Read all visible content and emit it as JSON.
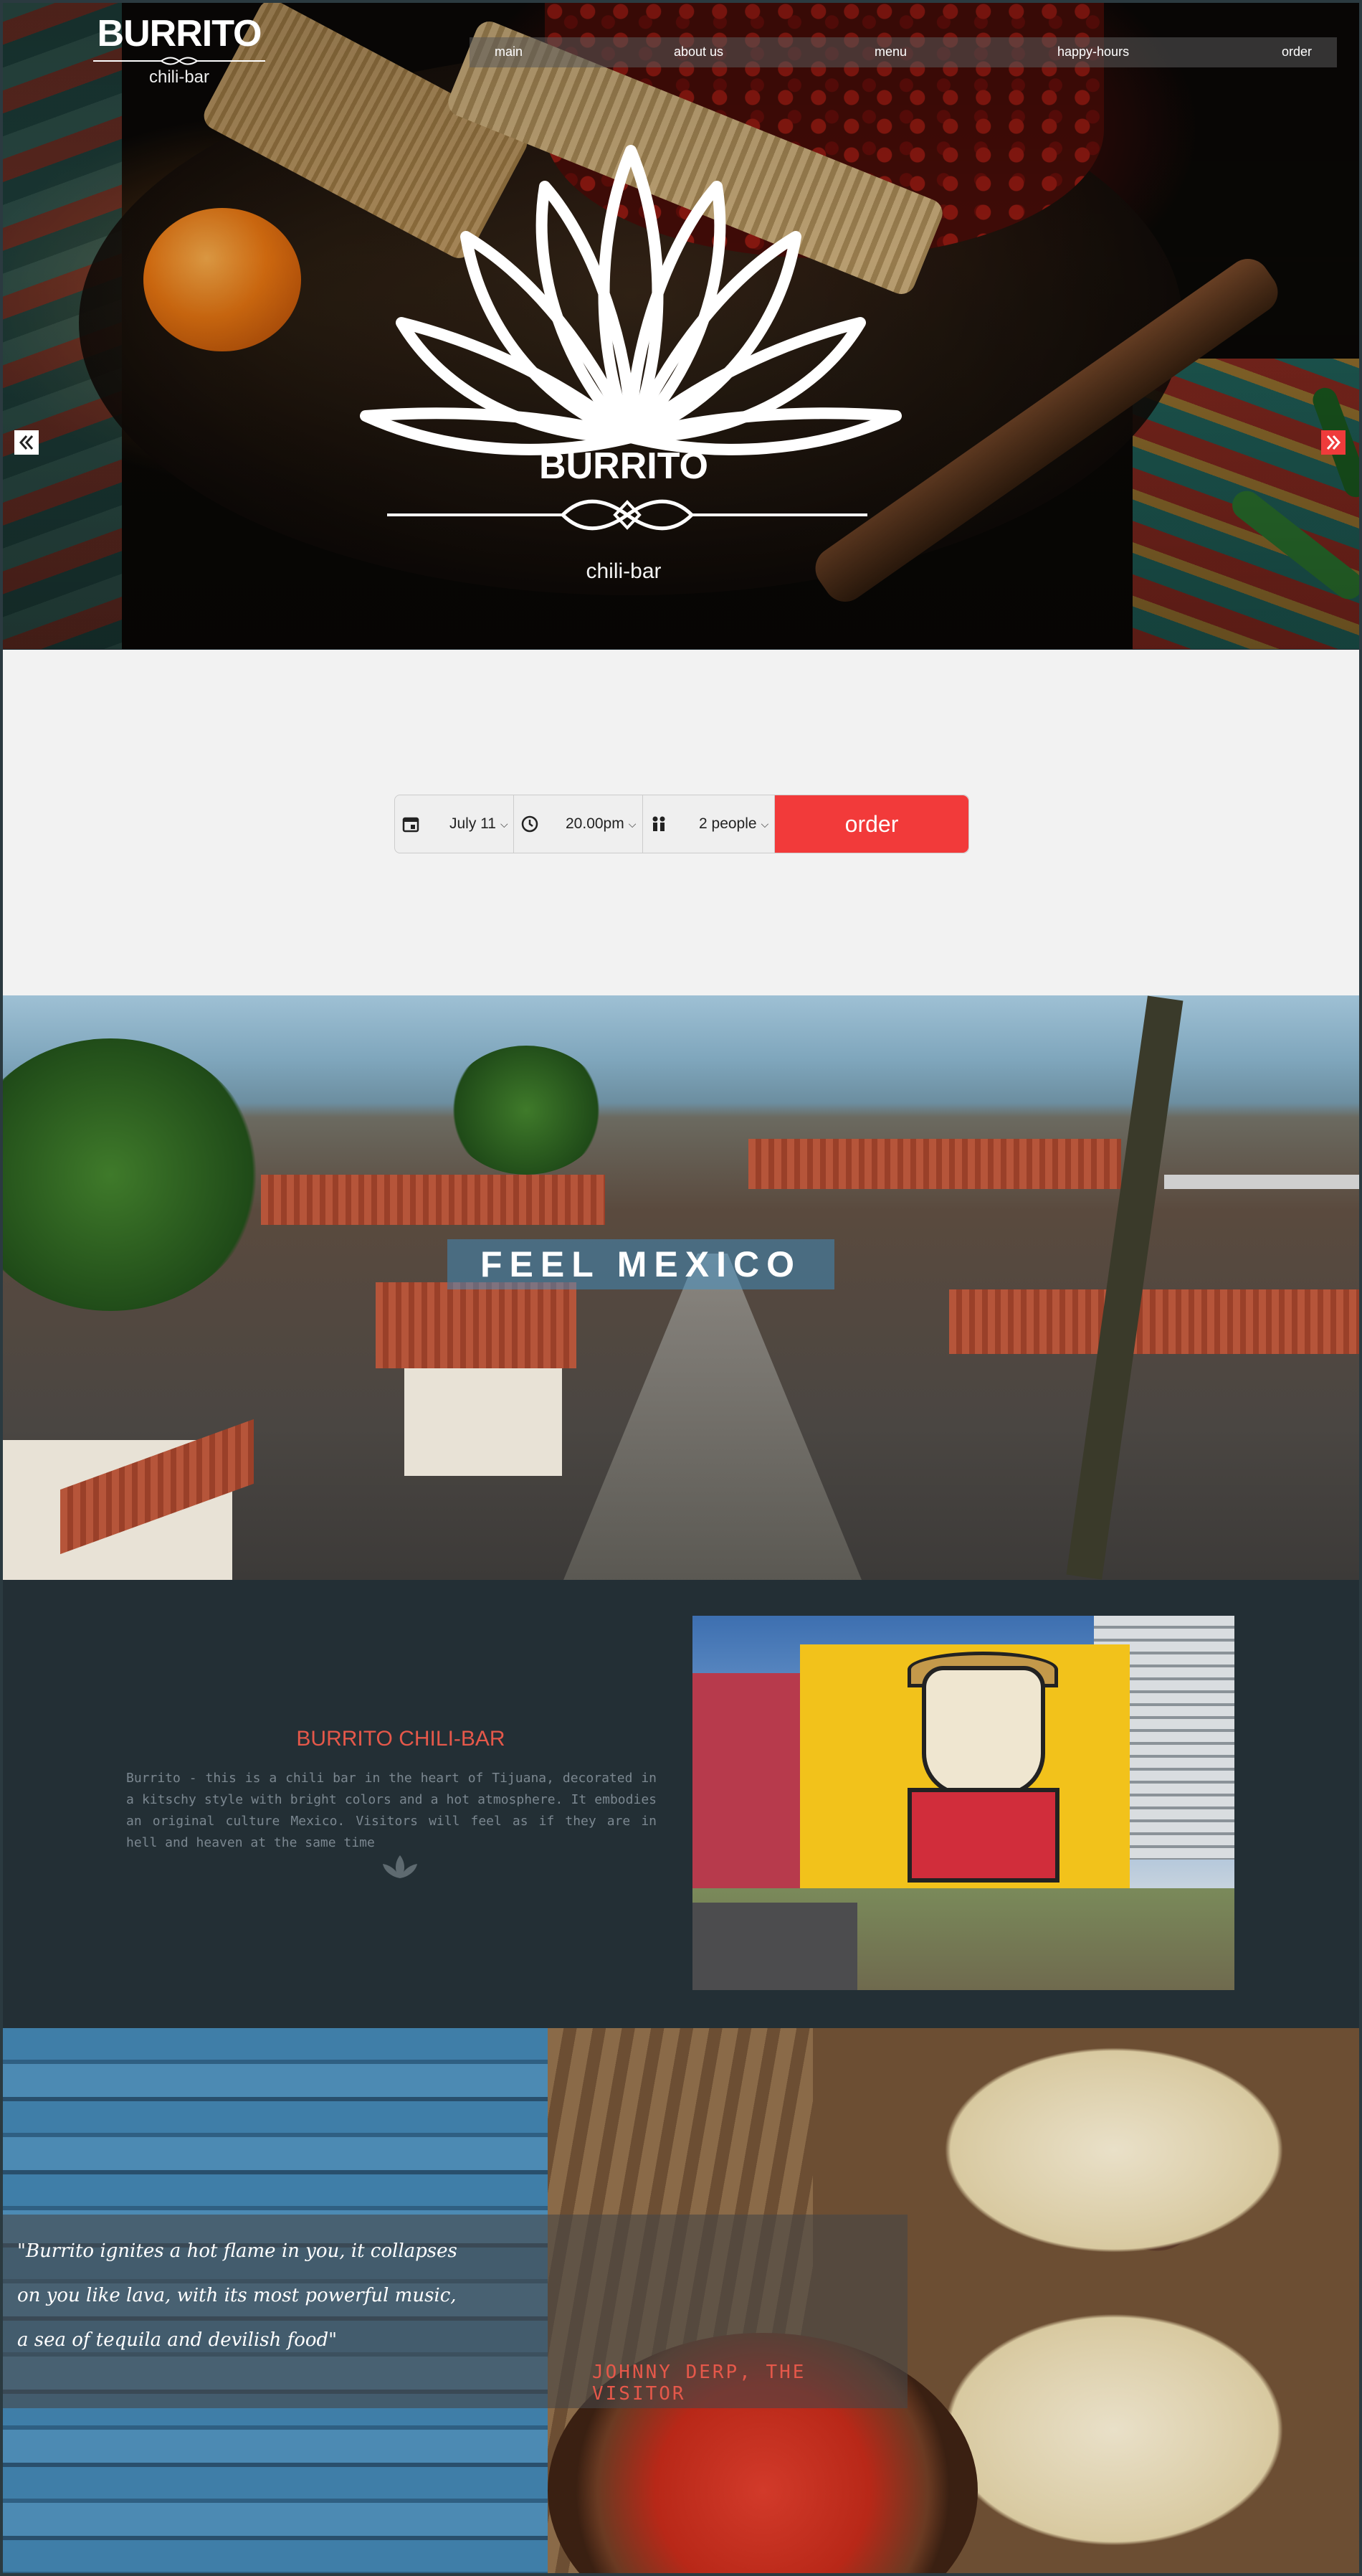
{
  "brand": {
    "name": "BURRITO",
    "sub": "chili-bar"
  },
  "nav": {
    "items": [
      {
        "label": "main"
      },
      {
        "label": "about us"
      },
      {
        "label": "menu"
      },
      {
        "label": "happy-hours"
      },
      {
        "label": "order"
      }
    ]
  },
  "hero": {
    "title": "BURRITO",
    "sub": "chili-bar",
    "prev_icon": "double-chevron-left",
    "next_icon": "double-chevron-right"
  },
  "booking": {
    "date": "July 11",
    "time": "20.00pm",
    "people": "2 people",
    "button": "order",
    "icons": [
      "calendar-icon",
      "clock-icon",
      "people-icon"
    ]
  },
  "mexico": {
    "caption": "FEEL MEXICO"
  },
  "about": {
    "title": "BURRITO CHILI-BAR",
    "text": "Burrito - this is a chili bar in the heart of Tijuana, decorated in a kitschy style with bright colors and a hot atmosphere. It embodies an original culture Mexico. Visitors will feel as if they are in hell and heaven at the same time"
  },
  "quote": {
    "text": "\"Burrito ignites a hot flame in you, it collapses\non you like lava, with its most powerful music,\na sea of tequila and devilish food\"",
    "author": "JOHNNY DERP, THE VISITOR"
  },
  "colors": {
    "accent": "#f23a3a",
    "dark": "#232f35",
    "title_red": "#e5584a"
  }
}
